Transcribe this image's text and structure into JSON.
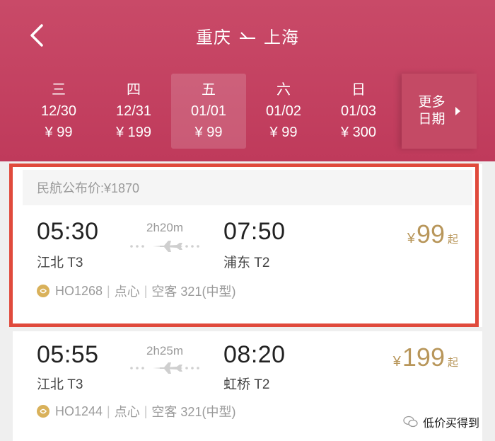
{
  "header": {
    "origin": "重庆",
    "destination": "上海",
    "back_icon": "chevron-left-icon",
    "route_arrow_icon": "one-way-arrow-icon",
    "bg_color": "#c2405f"
  },
  "dates": [
    {
      "weekday": "三",
      "date": "12/30",
      "price": "¥ 99",
      "selected": false
    },
    {
      "weekday": "四",
      "date": "12/31",
      "price": "¥ 199",
      "selected": false
    },
    {
      "weekday": "五",
      "date": "01/01",
      "price": "¥ 99",
      "selected": true
    },
    {
      "weekday": "六",
      "date": "01/02",
      "price": "¥ 99",
      "selected": false
    },
    {
      "weekday": "日",
      "date": "01/03",
      "price": "¥ 300",
      "selected": false
    }
  ],
  "more_dates": {
    "label": "更多 日期",
    "line1": "更多",
    "line2": "日期"
  },
  "public_price": "民航公布价:¥1870",
  "flights": [
    {
      "dep_time": "05:30",
      "dep_airport": "江北 T3",
      "duration": "2h20m",
      "arr_time": "07:50",
      "arr_airport": "浦东 T2",
      "price_currency": "¥",
      "price": "99",
      "price_suffix": "起",
      "flight_no": "HO1268",
      "meal": "点心",
      "aircraft": "空客 321(中型)"
    },
    {
      "dep_time": "05:55",
      "dep_airport": "江北 T3",
      "duration": "2h25m",
      "arr_time": "08:20",
      "arr_airport": "虹桥 T2",
      "price_currency": "¥",
      "price": "199",
      "price_suffix": "起",
      "flight_no": "HO1244",
      "meal": "点心",
      "aircraft": "空客 321(中型)"
    }
  ],
  "watermark": "低价买得到",
  "colors": {
    "price": "#b8965a",
    "highlight_border": "#e04a3c"
  }
}
